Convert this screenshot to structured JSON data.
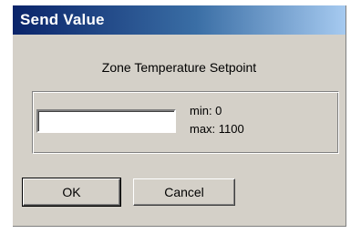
{
  "window": {
    "title": "Send Value"
  },
  "dialog": {
    "heading": "Zone Temperature Setpoint",
    "input": {
      "value": "",
      "placeholder": ""
    },
    "range": {
      "min_label": "min: 0",
      "max_label": "max: 1100"
    }
  },
  "buttons": {
    "ok_label": "OK",
    "cancel_label": "Cancel"
  },
  "colors": {
    "title_bar_start": "#0a246a",
    "title_bar_end": "#a6caf0",
    "dialog_background": "#d4d0c8"
  }
}
